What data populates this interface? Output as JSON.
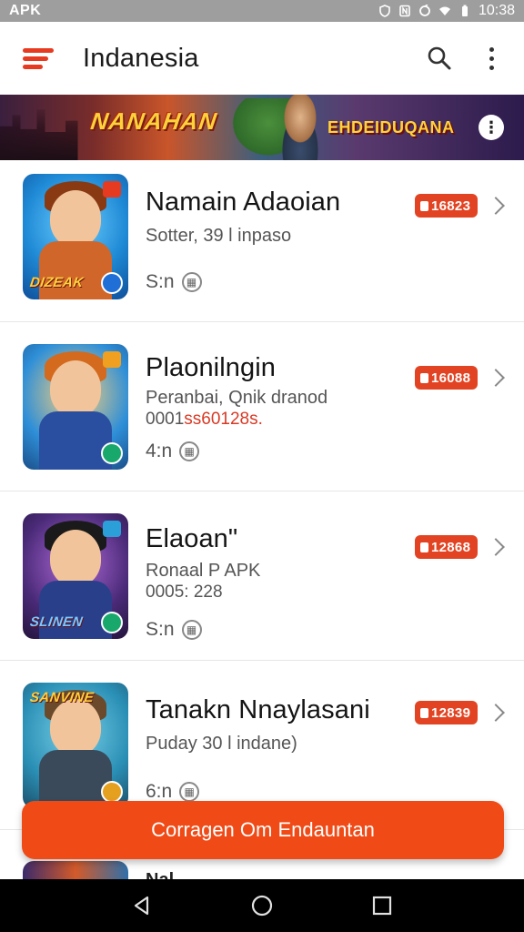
{
  "status_bar": {
    "left_label": "APK",
    "time": "10:38"
  },
  "app_bar": {
    "title": "Indanesia"
  },
  "banner": {
    "left_text": "NANAHAN",
    "right_text": "EHDEIDUQANA"
  },
  "items": [
    {
      "title": "Namain Adaoian",
      "subtitle": "Sotter, 39 l inpaso",
      "detail": "",
      "rating": "S:n",
      "badge": "16823",
      "thumb": {
        "bg": "#1f8ad6",
        "hair": "#8a3a12",
        "body": "#d0662a",
        "tag": "DIZEAK"
      }
    },
    {
      "title": "Plaonilngin",
      "subtitle": "Peranbai, Qnik dranod",
      "detail_prefix": "0001",
      "detail_highlight": "ss60128s.",
      "rating": "4:n",
      "badge": "16088",
      "thumb": {
        "bg": "#2e8fd8",
        "hair": "#d36a1e",
        "body": "#2a4fa0",
        "tag": ""
      }
    },
    {
      "title": "Elaoan\"",
      "subtitle": "Ronaal P APK",
      "detail": "0005: 228",
      "rating": "S:n",
      "badge": "12868",
      "thumb": {
        "bg": "#4a2a78",
        "hair": "#1a1a1a",
        "body": "#2a3f8a",
        "tag": "SLINEN"
      }
    },
    {
      "title": "Tanakn Nnaylasani",
      "subtitle": "Puday 30 l indane)",
      "detail": "",
      "rating": "6:n",
      "badge": "12839",
      "thumb": {
        "bg": "#2a8fb5",
        "hair": "#6a4a2a",
        "body": "#3a4a5a",
        "tag": "SANVINE"
      }
    }
  ],
  "cta": {
    "label": "Corragen Om Endauntan"
  },
  "peek": {
    "text": "Nal"
  },
  "colors": {
    "accent": "#f04a16",
    "badge": "#e24423",
    "status_bar": "#9e9e9e"
  }
}
